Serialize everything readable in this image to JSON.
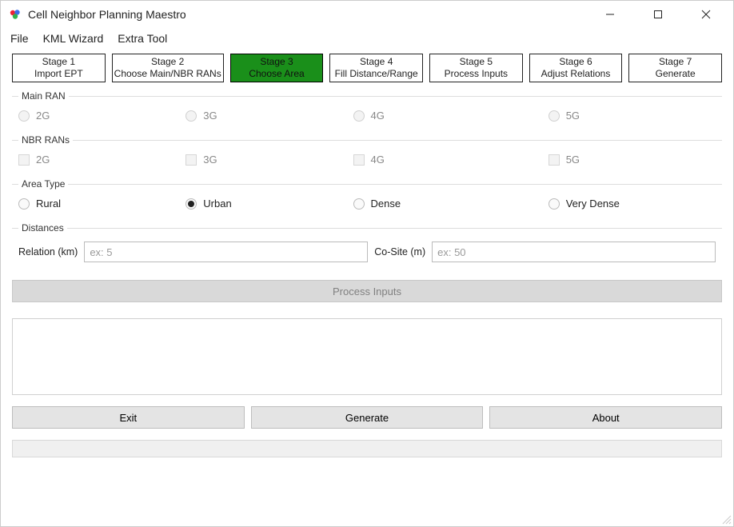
{
  "window": {
    "title": "Cell Neighbor Planning Maestro"
  },
  "menu": {
    "file": "File",
    "kml": "KML Wizard",
    "extra": "Extra Tool"
  },
  "stages": [
    {
      "line1": "Stage 1",
      "line2": "Import EPT"
    },
    {
      "line1": "Stage 2",
      "line2": "Choose Main/NBR RANs"
    },
    {
      "line1": "Stage 3",
      "line2": "Choose Area"
    },
    {
      "line1": "Stage 4",
      "line2": "Fill Distance/Range"
    },
    {
      "line1": "Stage 5",
      "line2": "Process Inputs"
    },
    {
      "line1": "Stage 6",
      "line2": "Adjust Relations"
    },
    {
      "line1": "Stage 7",
      "line2": "Generate"
    }
  ],
  "active_stage_index": 2,
  "groups": {
    "main_ran": {
      "legend": "Main RAN",
      "options": [
        "2G",
        "3G",
        "4G",
        "5G"
      ]
    },
    "nbr_rans": {
      "legend": "NBR RANs",
      "options": [
        "2G",
        "3G",
        "4G",
        "5G"
      ]
    },
    "area_type": {
      "legend": "Area Type",
      "options": [
        "Rural",
        "Urban",
        "Dense",
        "Very Dense"
      ],
      "selected_index": 1
    },
    "distances": {
      "legend": "Distances",
      "relation_label": "Relation (km)",
      "relation_placeholder": "ex: 5",
      "cosite_label": "Co-Site (m)",
      "cosite_placeholder": "ex: 50"
    }
  },
  "buttons": {
    "process": "Process Inputs",
    "exit": "Exit",
    "generate": "Generate",
    "about": "About"
  }
}
